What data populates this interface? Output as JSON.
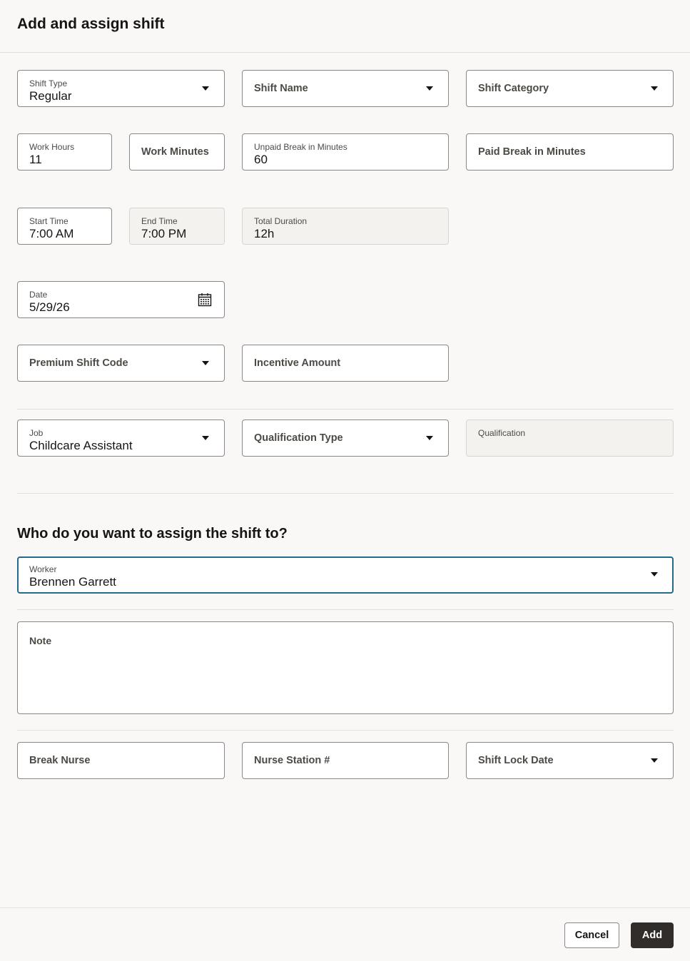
{
  "dialog": {
    "title": "Add and assign shift"
  },
  "fields": {
    "shift_type": {
      "label": "Shift Type",
      "value": "Regular"
    },
    "shift_name": {
      "placeholder": "Shift Name"
    },
    "shift_category": {
      "placeholder": "Shift Category"
    },
    "work_hours": {
      "label": "Work Hours",
      "value": "11"
    },
    "work_minutes": {
      "placeholder": "Work Minutes"
    },
    "unpaid_break": {
      "label": "Unpaid Break in Minutes",
      "value": "60"
    },
    "paid_break": {
      "placeholder": "Paid Break in Minutes"
    },
    "start_time": {
      "label": "Start Time",
      "value": "7:00 AM"
    },
    "end_time": {
      "label": "End Time",
      "value": "7:00 PM"
    },
    "total_duration": {
      "label": "Total Duration",
      "value": "12h"
    },
    "date": {
      "label": "Date",
      "value": "5/29/26"
    },
    "premium_shift_code": {
      "placeholder": "Premium Shift Code"
    },
    "incentive_amount": {
      "placeholder": "Incentive Amount"
    },
    "job": {
      "label": "Job",
      "value": "Childcare Assistant"
    },
    "qualification_type": {
      "placeholder": "Qualification Type"
    },
    "qualification": {
      "label": "Qualification",
      "value": ""
    },
    "worker": {
      "label": "Worker",
      "value": "Brennen Garrett"
    },
    "note": {
      "placeholder": "Note"
    },
    "break_nurse": {
      "placeholder": "Break Nurse"
    },
    "nurse_station": {
      "placeholder": "Nurse Station #"
    },
    "shift_lock_date": {
      "placeholder": "Shift Lock Date"
    }
  },
  "assign_section": {
    "title": "Who do you want to assign the shift to?"
  },
  "footer": {
    "cancel_label": "Cancel",
    "add_label": "Add"
  },
  "colors": {
    "focus_border": "#246a8a",
    "primary_button": "#312d2a",
    "background": "#f9f8f6"
  }
}
